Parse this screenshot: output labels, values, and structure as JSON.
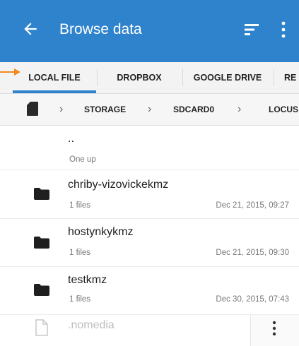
{
  "app_bar": {
    "title": "Browse data",
    "back_icon": "arrow-left-icon",
    "sort_icon": "sort-icon",
    "menu_icon": "more-vert-icon",
    "color": "#2f83cc"
  },
  "tabs": [
    {
      "label": "LOCAL FILE",
      "selected": true
    },
    {
      "label": "DROPBOX",
      "selected": false
    },
    {
      "label": "GOOGLE DRIVE",
      "selected": false
    },
    {
      "label": "RE",
      "selected": false
    }
  ],
  "breadcrumb": {
    "root_icon": "sd-card-icon",
    "items": [
      "STORAGE",
      "SDCARD0",
      "LOCUS"
    ]
  },
  "files": [
    {
      "name": "..",
      "sub": "One up",
      "date": "",
      "icon": ""
    },
    {
      "name": "chriby-vizovickekmz",
      "sub": "1 files",
      "date": "Dec 21, 2015, 09:27",
      "icon": "folder-icon"
    },
    {
      "name": "hostynkykmz",
      "sub": "1 files",
      "date": "Dec 21, 2015, 09:30",
      "icon": "folder-icon"
    },
    {
      "name": "testkmz",
      "sub": "1 files",
      "date": "Dec 30, 2015, 07:43",
      "icon": "folder-icon"
    },
    {
      "name": ".nomedia",
      "sub": "",
      "date": "",
      "icon": "file-icon"
    }
  ],
  "annotation": {
    "color": "#f28a1e",
    "icon": "arrow-right-icon"
  }
}
